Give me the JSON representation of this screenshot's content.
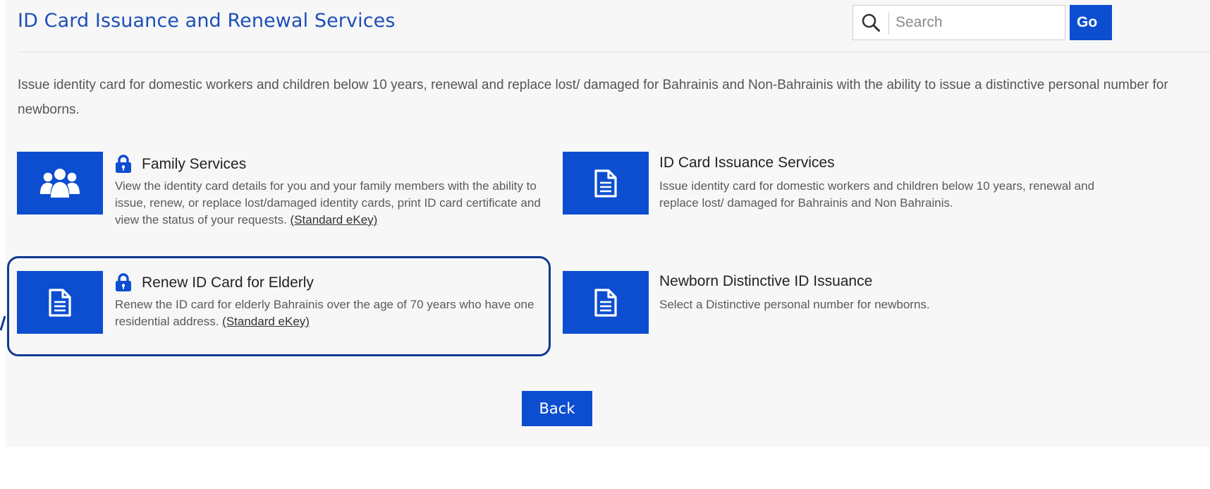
{
  "header": {
    "title": "ID Card Issuance and Renewal Services",
    "search_placeholder": "Search",
    "search_value": "",
    "go_label": "Go"
  },
  "intro": {
    "text": "Issue identity card for domestic workers and children below 10 years, renewal and replace lost/ damaged for Bahrainis and Non-Bahrainis with the ability to issue a distinctive personal number for newborns."
  },
  "services": {
    "family": {
      "title": "Family Services",
      "description": "View the identity card details for you and your family members with the ability to issue, renew, or replace lost/damaged identity cards, print ID card certificate and view the status of your requests.",
      "ekey": "(Standard eKey)",
      "icon": "family-icon",
      "locked": true
    },
    "issuance": {
      "title": "ID Card Issuance Services",
      "description": "Issue identity card for domestic workers and children below 10 years, renewal and replace lost/ damaged for Bahrainis and Non Bahrainis.",
      "icon": "document-icon",
      "locked": false
    },
    "elderly": {
      "title": "Renew ID Card for Elderly",
      "description": "Renew the ID card for elderly Bahrainis over the age of 70 years who have one residential address.",
      "ekey": "(Standard eKey)",
      "icon": "document-icon",
      "locked": true,
      "highlighted": true
    },
    "newborn": {
      "title": "Newborn Distinctive ID Issuance",
      "description": "Select a Distinctive personal number for newborns.",
      "icon": "document-icon",
      "locked": false
    }
  },
  "footer": {
    "back_label": "Back"
  },
  "colors": {
    "accent": "#0d4ed1",
    "title": "#1d4fb8",
    "highlight_border": "#123a8f",
    "panel_bg": "#f7f7f7"
  }
}
